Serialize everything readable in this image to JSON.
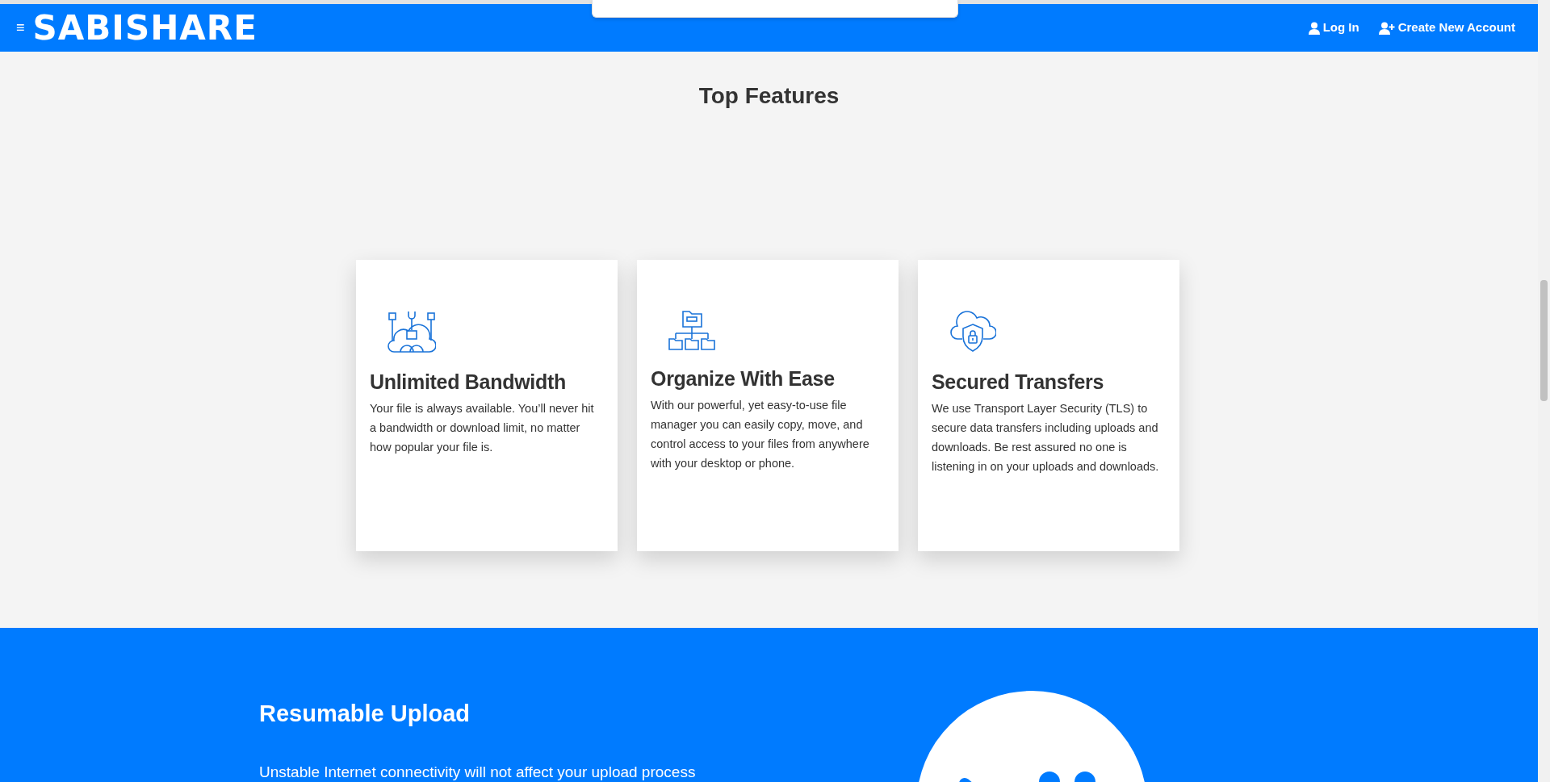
{
  "navbar": {
    "menu_glyph": "≡",
    "brand": "SABISHARE",
    "links": [
      {
        "kind": "login",
        "label": "Log In"
      },
      {
        "kind": "signup",
        "label": "Create New Account"
      }
    ]
  },
  "features": {
    "title": "Top Features",
    "cards": [
      {
        "title": "Unlimited Bandwidth",
        "text": "Your file is always available. You’ll never hit a bandwidth or download limit, no matter how popular your file is."
      },
      {
        "title": "Organize With Ease",
        "text": "With our powerful, yet easy-to-use file manager you can easily copy, move, and control access to your files from anywhere with your desktop or phone."
      },
      {
        "title": "Secured Transfers",
        "text": "We use Transport Layer Security (TLS) to secure data transfers including uploads and downloads. Be rest assured no one is listening in on your uploads and downloads."
      }
    ]
  },
  "resumable": {
    "title": "Resumable Upload",
    "text": "Unstable Internet connectivity will not affect your upload process"
  }
}
